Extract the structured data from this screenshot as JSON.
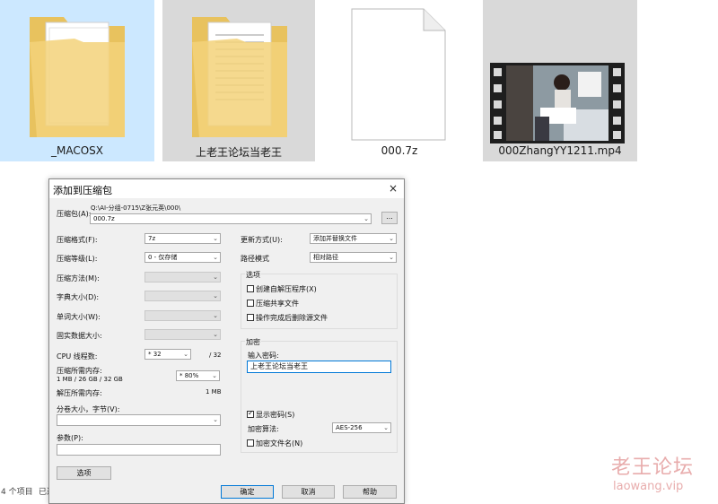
{
  "files": [
    {
      "name": "_MACOSX",
      "type": "folder",
      "selected": true
    },
    {
      "name": "上老王论坛当老王",
      "type": "folder",
      "selected": false
    },
    {
      "name": "000.7z",
      "type": "file",
      "selected": false
    },
    {
      "name": "000ZhangYY1211.mp4",
      "type": "video",
      "selected": false
    }
  ],
  "status": {
    "count": "4 个项目",
    "selected_prefix": "已选"
  },
  "dialog": {
    "title": "添加到压缩包",
    "close": "×",
    "archive_label": "压缩包(A):",
    "archive_path": "Q:\\AI-分组-0715\\Z张元英\\000\\",
    "archive_name": "000.7z",
    "browse": "...",
    "format_label": "压缩格式(F):",
    "format_value": "7z",
    "level_label": "压缩等级(L):",
    "level_value": "0 - 仅存储",
    "method_label": "压缩方法(M):",
    "dict_label": "字典大小(D):",
    "word_label": "单词大小(W):",
    "solid_label": "固实数据大小:",
    "threads_label": "CPU 线程数:",
    "threads_value": "* 32",
    "threads_total": "/ 32",
    "mem_compress_label": "压缩所需内存:",
    "mem_compress_value": "1 MB / 26 GB / 32 GB",
    "mem_percent": "* 80%",
    "mem_decompress_label": "解压所需内存:",
    "mem_decompress_value": "1 MB",
    "split_label": "分卷大小，字节(V):",
    "params_label": "参数(P):",
    "options_btn": "选项",
    "update_label": "更新方式(U):",
    "update_value": "添加并替换文件",
    "path_label": "路径模式",
    "path_value": "相对路径",
    "options_group": "选项",
    "opt_sfx": "创建自解压程序(X)",
    "opt_shared": "压缩共享文件",
    "opt_delete": "操作完成后删除源文件",
    "encrypt_group": "加密",
    "password_label": "输入密码:",
    "password_value": "上老王论坛当老王",
    "show_password": "显示密码(S)",
    "encrypt_method_label": "加密算法:",
    "encrypt_method_value": "AES-256",
    "encrypt_names": "加密文件名(N)",
    "ok": "确定",
    "cancel": "取消",
    "help": "帮助"
  },
  "watermark": {
    "line1": "老王论坛",
    "line2": "laowang.vip"
  },
  "colors": {
    "selection": "#cce8ff",
    "tile_gray": "#d9d9d9",
    "dialog_bg": "#f0f0f0",
    "accent": "#0078d7"
  }
}
